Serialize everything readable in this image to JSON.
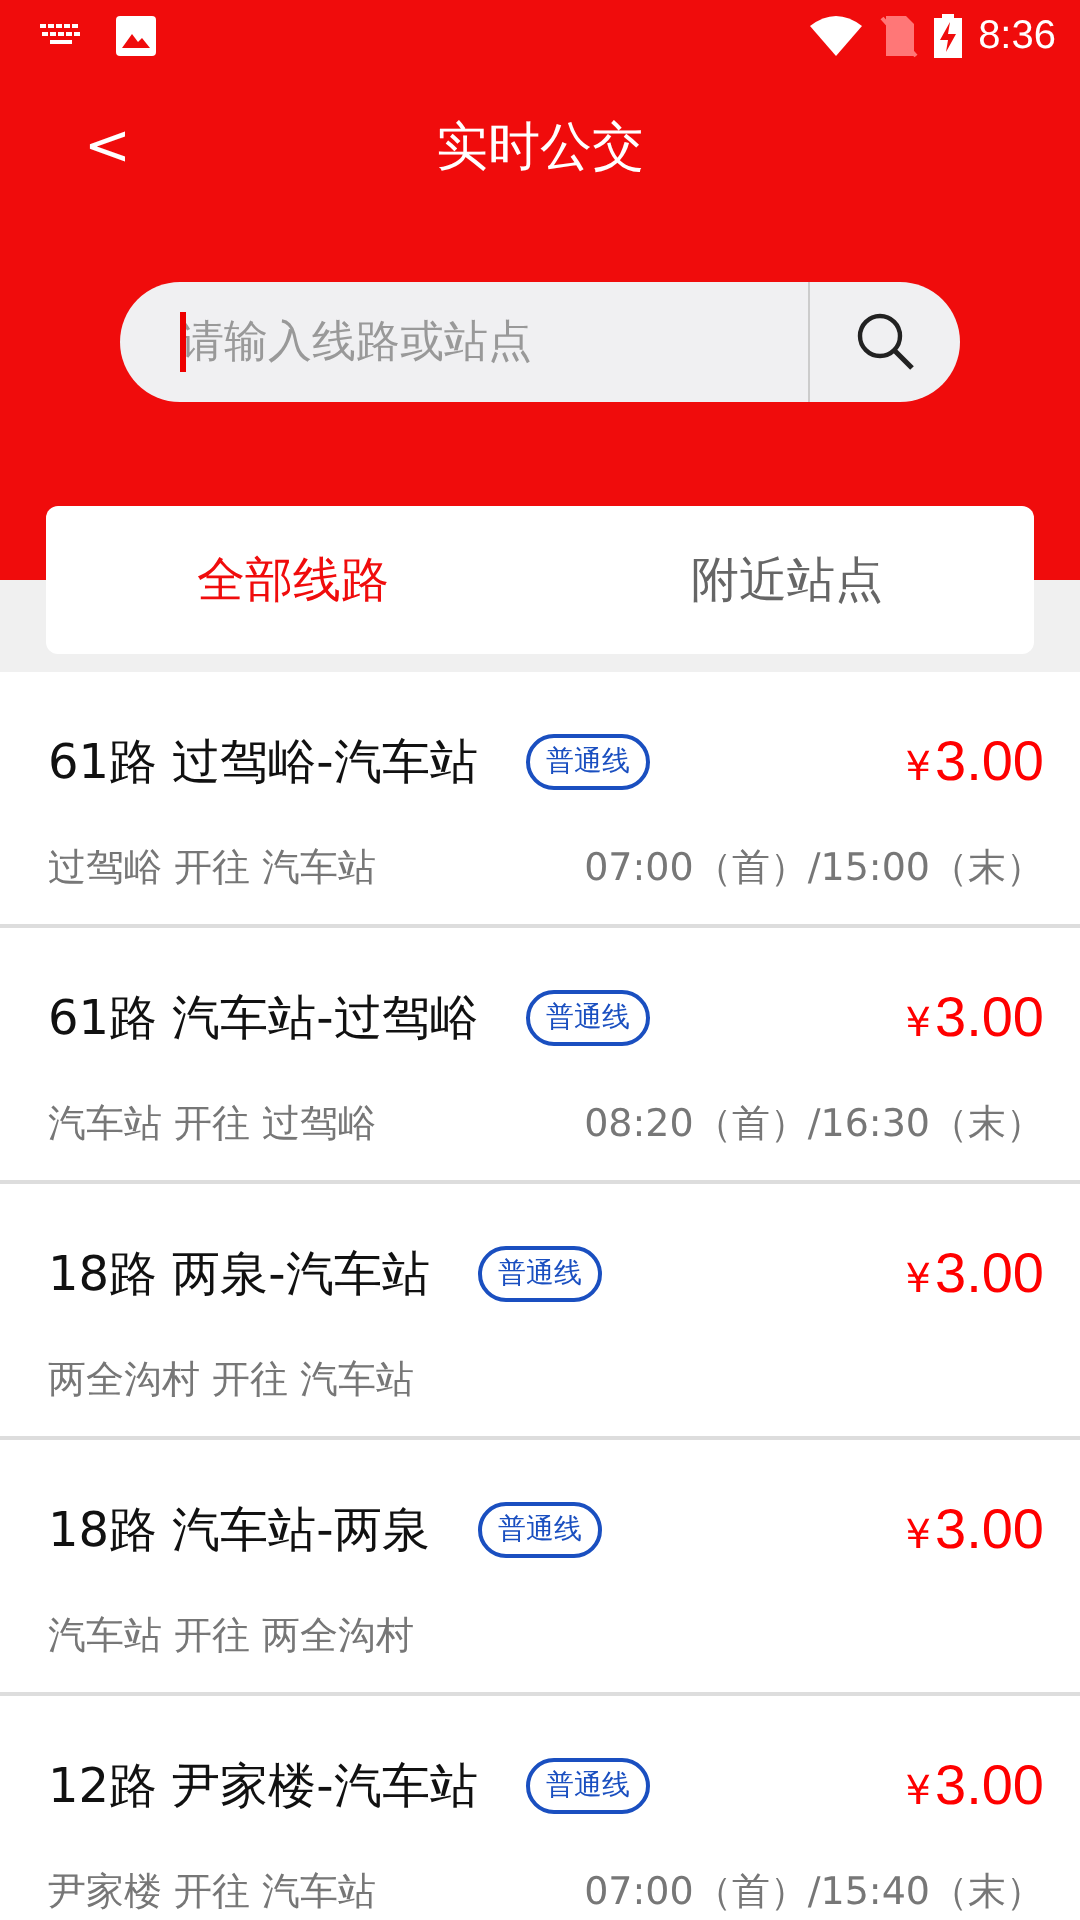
{
  "status_bar": {
    "time": "8:36"
  },
  "header": {
    "back": "<",
    "title": "实时公交"
  },
  "search": {
    "placeholder": "请输入线路或站点"
  },
  "tabs": [
    {
      "label": "全部线路",
      "selected": true
    },
    {
      "label": "附近站点",
      "selected": false
    }
  ],
  "routes": [
    {
      "name": "61路 过驾峪-汽车站",
      "tag": "普通线",
      "currency": "¥",
      "price": "3.00",
      "direction": "过驾峪 开往 汽车站",
      "hours": "07:00（首）/15:00（末）"
    },
    {
      "name": "61路 汽车站-过驾峪",
      "tag": "普通线",
      "currency": "¥",
      "price": "3.00",
      "direction": "汽车站 开往 过驾峪",
      "hours": "08:20（首）/16:30（末）"
    },
    {
      "name": "18路 两泉-汽车站",
      "tag": "普通线",
      "currency": "¥",
      "price": "3.00",
      "direction": "两全沟村 开往 汽车站"
    },
    {
      "name": "18路 汽车站-两泉",
      "tag": "普通线",
      "currency": "¥",
      "price": "3.00",
      "direction": "汽车站 开往 两全沟村"
    },
    {
      "name": "12路 尹家楼-汽车站",
      "tag": "普通线",
      "currency": "¥",
      "price": "3.00",
      "direction": "尹家楼 开往 汽车站",
      "hours": "07:00（首）/15:40（末）"
    }
  ]
}
